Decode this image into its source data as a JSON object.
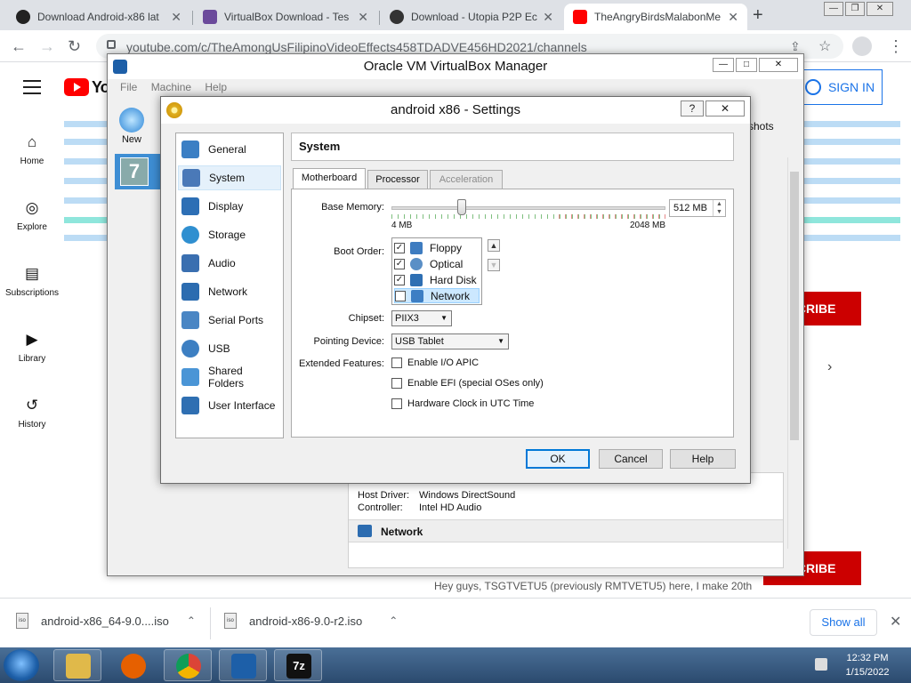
{
  "browser": {
    "tabs": [
      {
        "title": "Download Android-x86 lat",
        "active": false,
        "favicon_color": "#222222"
      },
      {
        "title": "VirtualBox Download - Tes",
        "active": false,
        "favicon_color": "#6b4a9b"
      },
      {
        "title": "Download - Utopia P2P Ec",
        "active": false,
        "favicon_color": "#333333"
      },
      {
        "title": "TheAngryBirdsMalabonMe",
        "active": true,
        "favicon_color": "#ff0000"
      }
    ],
    "new_tab": "+",
    "url": "youtube.com/c/TheAmongUsFilipinoVideoEffects458TDADVE456HD2021/channels"
  },
  "youtube": {
    "logo_text": "Yo",
    "sign_in": "SIGN IN",
    "nav": [
      {
        "label": "Home",
        "icon": "home-icon"
      },
      {
        "label": "Explore",
        "icon": "compass-icon"
      },
      {
        "label": "Subscriptions",
        "icon": "subscriptions-icon"
      },
      {
        "label": "Library",
        "icon": "library-icon"
      },
      {
        "label": "History",
        "icon": "history-icon"
      }
    ],
    "subscribe_label": "SCRIBE",
    "description": "Hey guys, TSGTVETU5 (previously RMTVETU5) here, I make 20th"
  },
  "vbox_manager": {
    "title": "Oracle VM VirtualBox Manager",
    "menu": [
      "File",
      "Machine",
      "Help"
    ],
    "new_label": "New",
    "snapshots_label": "shots",
    "audio": {
      "host_driver_key": "Host Driver:",
      "host_driver": "Windows DirectSound",
      "controller_key": "Controller:",
      "controller": "Intel HD Audio"
    },
    "network_section": "Network"
  },
  "settings": {
    "title": "android x86 - Settings",
    "help_btn": "?",
    "close_btn": "✕",
    "categories": [
      {
        "label": "General",
        "icon": "general-icon",
        "color": "#3b7fc4",
        "selected": false
      },
      {
        "label": "System",
        "icon": "system-icon",
        "color": "#4a79b8",
        "selected": true
      },
      {
        "label": "Display",
        "icon": "display-icon",
        "color": "#2d6fb5",
        "selected": false
      },
      {
        "label": "Storage",
        "icon": "storage-icon",
        "color": "#2f8fd0",
        "selected": false
      },
      {
        "label": "Audio",
        "icon": "audio-icon",
        "color": "#3a6fb0",
        "selected": false
      },
      {
        "label": "Network",
        "icon": "network-icon",
        "color": "#2c6cb0",
        "selected": false
      },
      {
        "label": "Serial Ports",
        "icon": "serial-ports-icon",
        "color": "#4a86c4",
        "selected": false
      },
      {
        "label": "USB",
        "icon": "usb-icon",
        "color": "#3d7fc2",
        "selected": false
      },
      {
        "label": "Shared Folders",
        "icon": "shared-folders-icon",
        "color": "#4a95d6",
        "selected": false
      },
      {
        "label": "User Interface",
        "icon": "user-interface-icon",
        "color": "#2f6fb2",
        "selected": false
      }
    ],
    "page_title": "System",
    "tabs": [
      "Motherboard",
      "Processor",
      "Acceleration"
    ],
    "base_memory": {
      "label": "Base Memory:",
      "value": "512 MB",
      "min": "4 MB",
      "max": "2048 MB",
      "fraction": 0.25
    },
    "boot_order": {
      "label": "Boot Order:",
      "items": [
        {
          "label": "Floppy",
          "checked": true,
          "icon_color": "#3e7cc0"
        },
        {
          "label": "Optical",
          "checked": true,
          "icon_color": "#5a8fc6"
        },
        {
          "label": "Hard Disk",
          "checked": true,
          "icon_color": "#2e6fb3"
        },
        {
          "label": "Network",
          "checked": false,
          "icon_color": "#3d7ec4"
        }
      ]
    },
    "chipset": {
      "label": "Chipset:",
      "value": "PIIX3"
    },
    "pointing_device": {
      "label": "Pointing Device:",
      "value": "USB Tablet"
    },
    "extended_features": {
      "label": "Extended Features:",
      "options": [
        {
          "label": "Enable I/O APIC",
          "checked": false
        },
        {
          "label": "Enable EFI (special OSes only)",
          "checked": false
        },
        {
          "label": "Hardware Clock in UTC Time",
          "checked": false
        }
      ]
    },
    "buttons": {
      "ok": "OK",
      "cancel": "Cancel",
      "help": "Help"
    }
  },
  "downloads": {
    "items": [
      "android-x86_64-9.0....iso",
      "android-x86-9.0-r2.iso"
    ],
    "file_badge": "iso",
    "show_all": "Show all"
  },
  "taskbar": {
    "apps": [
      {
        "name": "explorer",
        "color": "#e0b94a"
      },
      {
        "name": "firefox",
        "color": "#e66000"
      },
      {
        "name": "chrome",
        "color": "#2da94f"
      },
      {
        "name": "virtualbox",
        "color": "#1d5fa8"
      },
      {
        "name": "7zip",
        "color": "#111111"
      }
    ],
    "time": "12:32 PM",
    "date": "1/15/2022"
  }
}
